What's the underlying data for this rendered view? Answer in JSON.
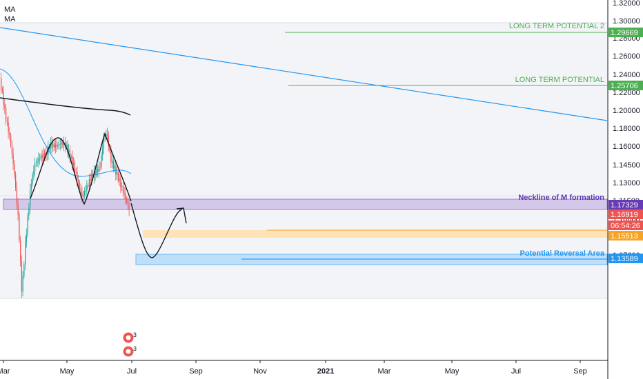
{
  "legend": {
    "indicators": [
      "MA",
      "MA"
    ]
  },
  "chart_data": {
    "type": "candlestick",
    "price_axis": {
      "ticks": [
        "1.32000",
        "1.30000",
        "1.28000",
        "1.26000",
        "1.24000",
        "1.22000",
        "1.20000",
        "1.18000",
        "1.16000",
        "1.14500",
        "1.13000",
        "1.11500",
        "1.10000",
        "1.08800",
        "1.07600"
      ]
    },
    "time_axis": {
      "ticks": [
        "Mar",
        "May",
        "Jul",
        "Sep",
        "Nov",
        "2021",
        "Mar",
        "May",
        "Jul",
        "Sep"
      ]
    },
    "price_tags": [
      {
        "label": "1.29669",
        "bg": "#4caf50"
      },
      {
        "label": "1.25706",
        "bg": "#4caf50"
      },
      {
        "label": "1.17329",
        "bg": "#673ab7"
      },
      {
        "label": "1.16919",
        "bg": "#ef5350"
      },
      {
        "label": "06:54:26",
        "bg": "#ef5350"
      },
      {
        "label": "1.15513",
        "bg": "#f7a325"
      },
      {
        "label": "1.13589",
        "bg": "#2196f3"
      }
    ],
    "annotations": [
      {
        "text": "LONG TERM POTENTIAL 2",
        "color": "#4caf50"
      },
      {
        "text": "LONG TERM POTENTIAL",
        "color": "#4caf50"
      },
      {
        "text": "Neckline of M formation",
        "color": "#5e35b1"
      },
      {
        "text": "Potential Reversal Area",
        "color": "#2196f3"
      }
    ],
    "events": [
      {
        "text": "3"
      },
      {
        "text": "3"
      }
    ],
    "colors": {
      "up": "#26a69a",
      "down": "#ef5350",
      "ma_fast": "#2196f3",
      "ma_slow": "#131722",
      "axis_text": "#131722",
      "grid": "#e0e3eb"
    }
  }
}
